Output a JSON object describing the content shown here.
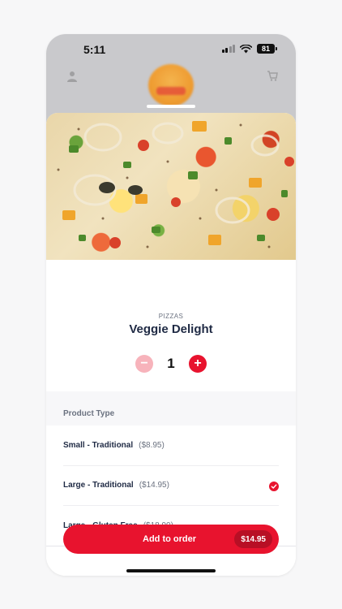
{
  "status_bar": {
    "time": "5:11",
    "battery": "81"
  },
  "product": {
    "category": "PIZZAS",
    "title": "Veggie Delight",
    "quantity": "1",
    "minus_symbol": "−",
    "plus_symbol": "+"
  },
  "options_section": {
    "header": "Product Type",
    "options": [
      {
        "name": "Small - Traditional",
        "price": "($8.95)",
        "selected": false
      },
      {
        "name": "Large - Traditional",
        "price": "($14.95)",
        "selected": true
      },
      {
        "name": "Large - Gluten Free",
        "price": "($18.90)",
        "selected": false
      }
    ]
  },
  "order_button": {
    "label": "Add to order",
    "price": "$14.95"
  },
  "colors": {
    "accent": "#e8132e",
    "accent_light": "#f7b3bb",
    "text_primary": "#1f2a44",
    "text_secondary": "#6b7280"
  },
  "icons": {
    "bg_left": "person-icon",
    "bg_right": "cart-icon",
    "check": "check-icon"
  }
}
